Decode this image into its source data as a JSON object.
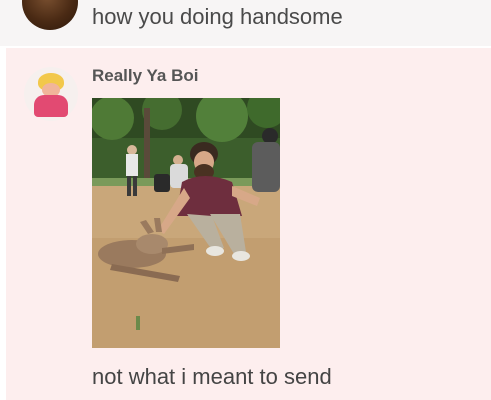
{
  "previous_message": {
    "text": "how you doing handsome"
  },
  "current_message": {
    "author": "Really Ya Boi",
    "image_alt": "photo of a man crouching next to a lying kangaroo",
    "caption": "not what i meant to send"
  }
}
